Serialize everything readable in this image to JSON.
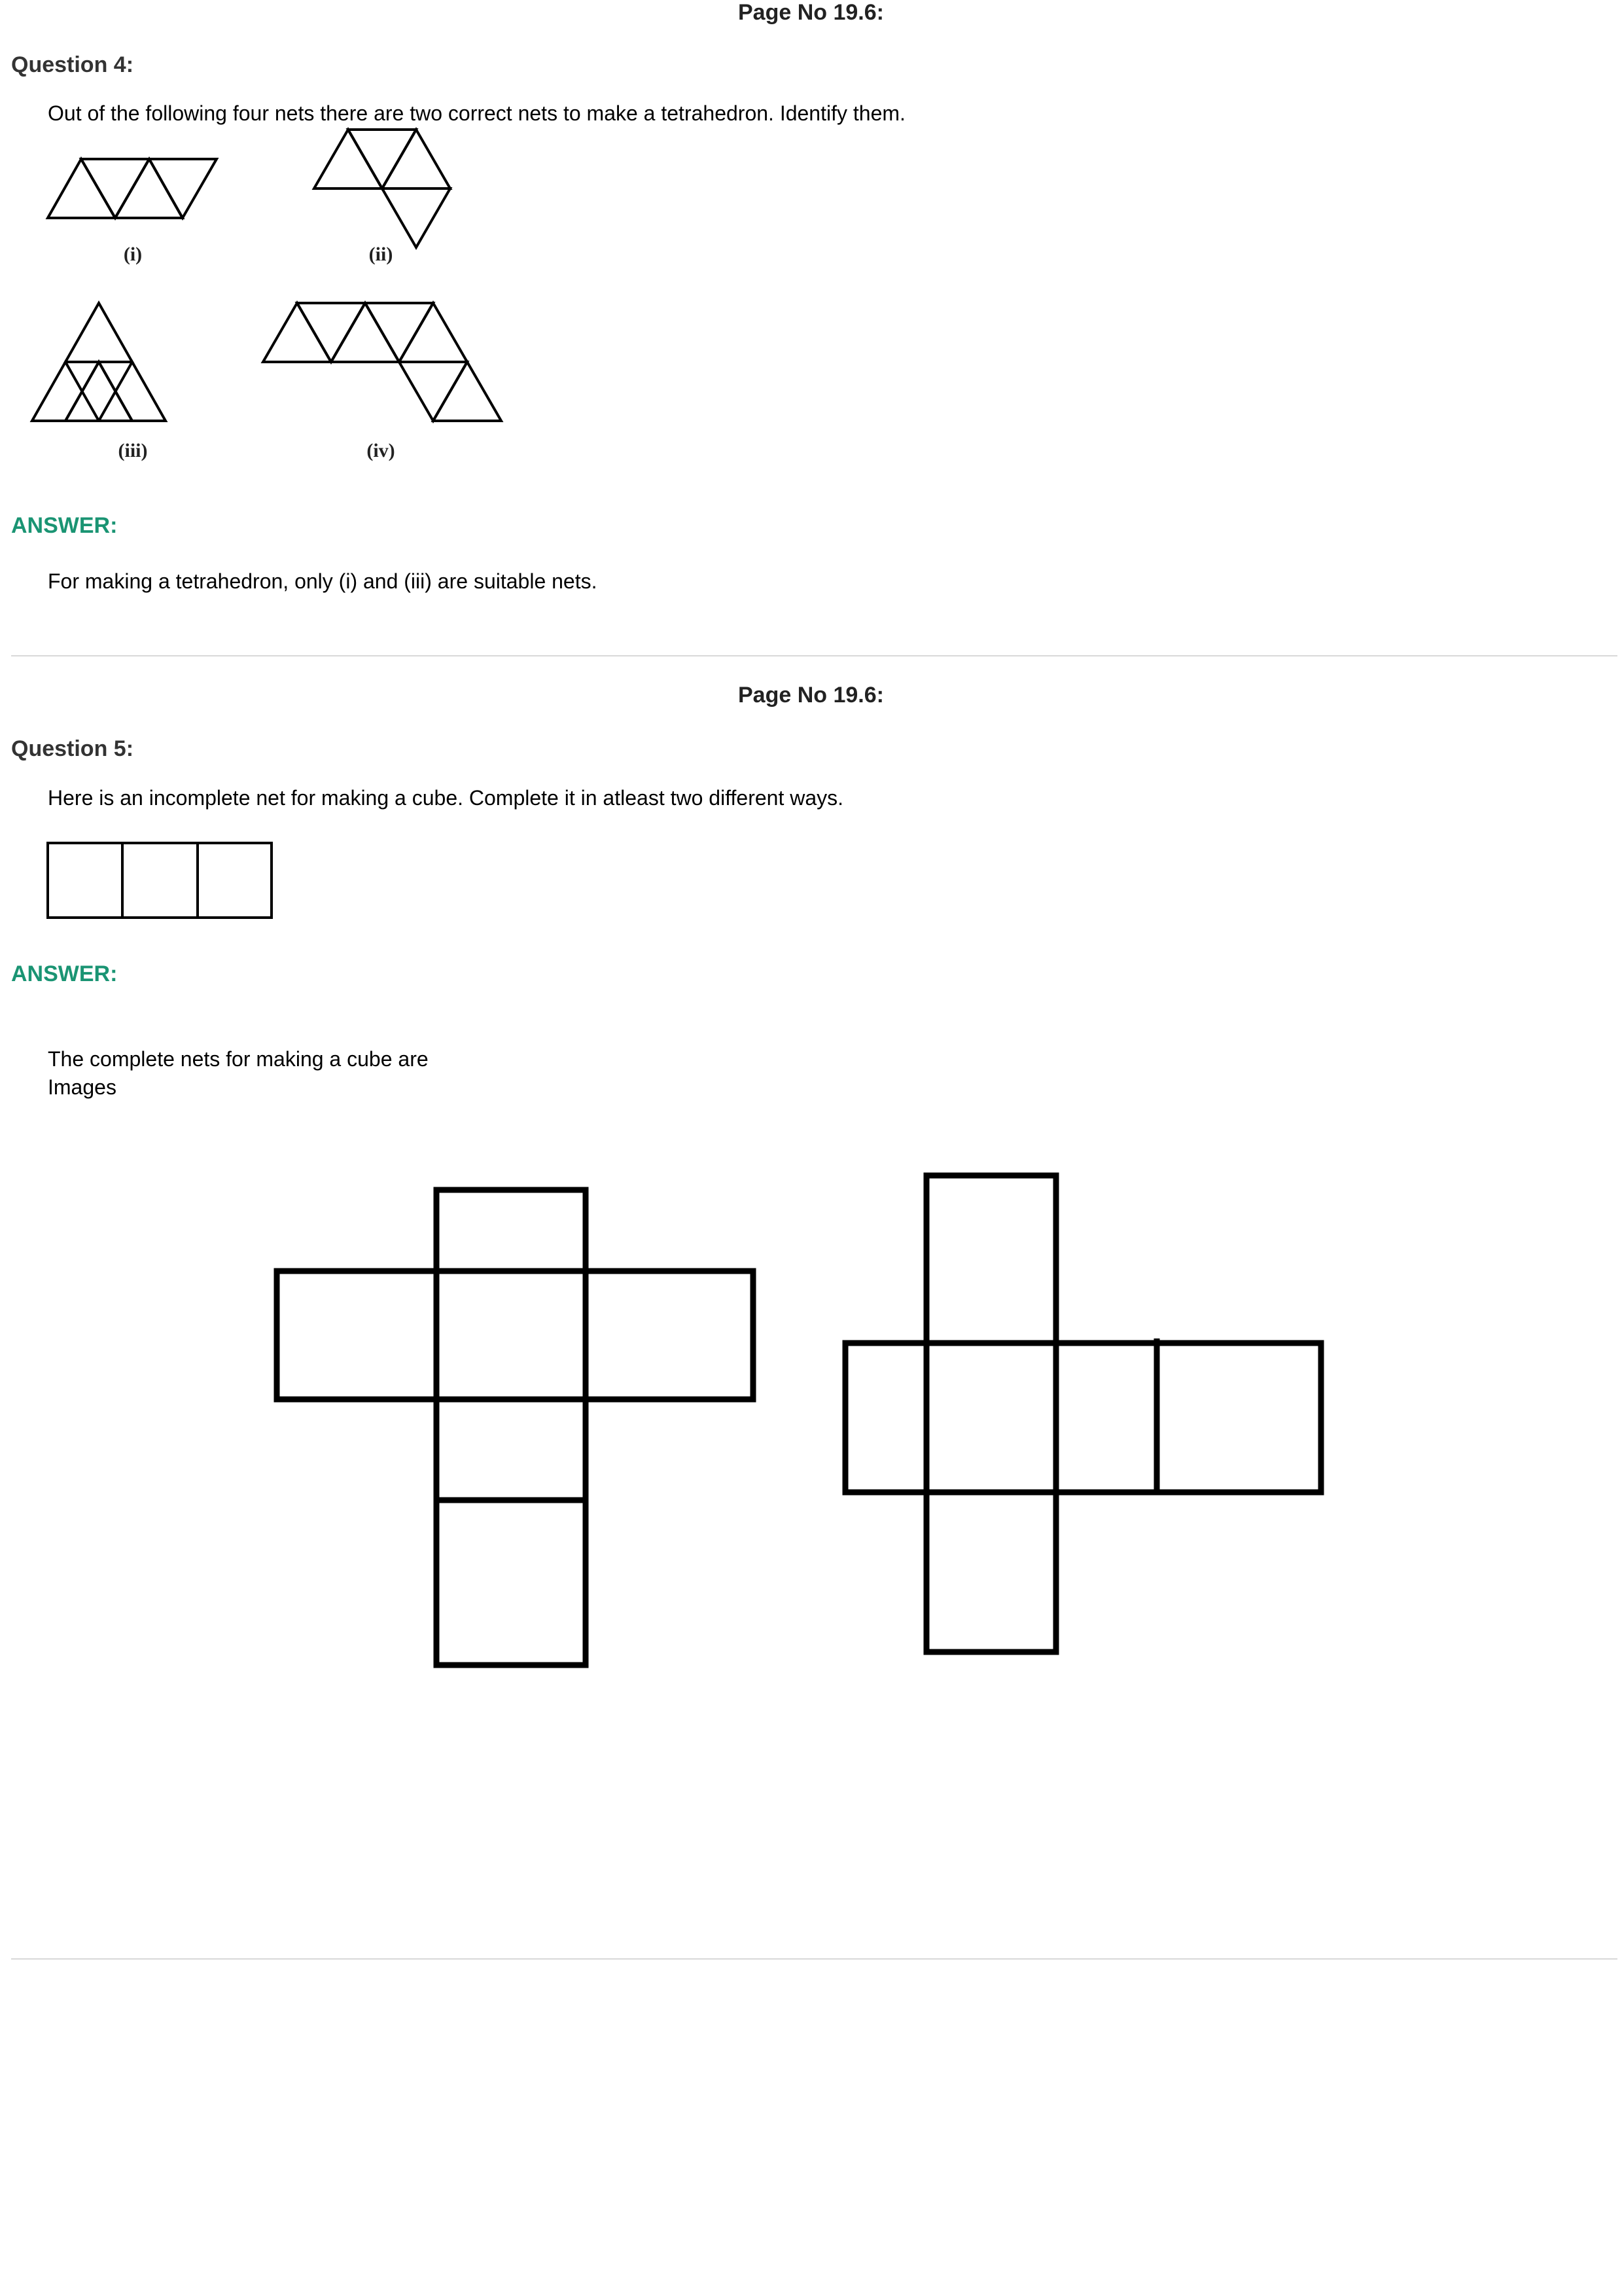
{
  "sections": [
    {
      "page_no": "Page No 19.6:",
      "question_label": "Question 4:",
      "question_text": "Out of the following four nets there are two correct nets to make a tetrahedron. Identify them.",
      "figure_labels": [
        "(i)",
        "(ii)",
        "(iii)",
        "(iv)"
      ],
      "answer_label": "ANSWER:",
      "answer_text": "For making a tetrahedron, only (i) and (iii) are suitable nets."
    },
    {
      "page_no": "Page No 19.6:",
      "question_label": "Question 5:",
      "question_text": "Here is an incomplete net for making a cube. Complete it in atleast two different ways.",
      "answer_label": "ANSWER:",
      "answer_text_line1": "The complete nets for making a cube are",
      "answer_text_line2": "Images"
    }
  ]
}
